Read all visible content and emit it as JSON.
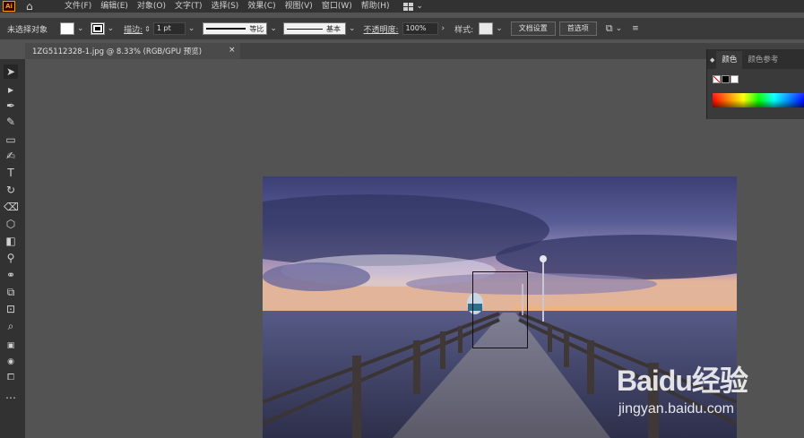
{
  "app": {
    "logo_text": "Ai"
  },
  "menu": {
    "items": [
      {
        "label": "文件(F)"
      },
      {
        "label": "编辑(E)"
      },
      {
        "label": "对象(O)"
      },
      {
        "label": "文字(T)"
      },
      {
        "label": "选择(S)"
      },
      {
        "label": "效果(C)"
      },
      {
        "label": "视图(V)"
      },
      {
        "label": "窗口(W)"
      },
      {
        "label": "帮助(H)"
      }
    ]
  },
  "control_bar": {
    "selection_status": "未选择对象",
    "stroke_label": "描边:",
    "stroke_weight": "1 pt",
    "profile_label": "等比",
    "brush_label": "基本",
    "opacity_label": "不透明度:",
    "opacity_value": "100%",
    "style_label": "样式:",
    "doc_setup_button": "文档设置",
    "preferences_button": "首选项"
  },
  "document_tab": {
    "title": "1ZG5112328-1.jpg @ 8.33% (RGB/GPU 预览)",
    "close_glyph": "×"
  },
  "color_panel": {
    "tabs": [
      {
        "label": "颜色",
        "active": true
      },
      {
        "label": "颜色参考",
        "active": false
      }
    ]
  },
  "watermark": {
    "brand": "Baidu经验",
    "url": "jingyan.baidu.com"
  },
  "colors": {
    "menubar_bg": "#323232",
    "control_bg": "#3a3a3a",
    "canvas_bg": "#535353",
    "logo_accent": "#ff9a00"
  }
}
